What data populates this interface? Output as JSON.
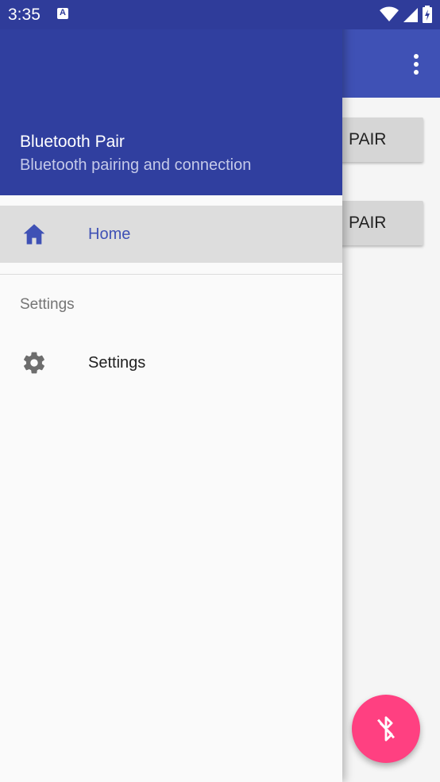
{
  "status_bar": {
    "time": "3:35",
    "notification_icon": "app-notification-icon",
    "icons": [
      "wifi-icon",
      "signal-icon",
      "battery-charging-icon"
    ]
  },
  "app": {
    "toolbar_color": "#3f51b5",
    "buttons": [
      {
        "label": "PAIR"
      },
      {
        "label": "PAIR"
      }
    ],
    "fab_icon": "bluetooth-disabled-icon",
    "fab_color": "#ff4081"
  },
  "drawer": {
    "header_color": "#303f9f",
    "title": "Bluetooth Pair",
    "subtitle": "Bluetooth pairing and connection",
    "items": [
      {
        "label": "Home",
        "icon": "home-icon",
        "selected": true,
        "color": "#3f51b5"
      }
    ],
    "section_label": "Settings",
    "section_items": [
      {
        "label": "Settings",
        "icon": "gear-icon"
      }
    ]
  }
}
